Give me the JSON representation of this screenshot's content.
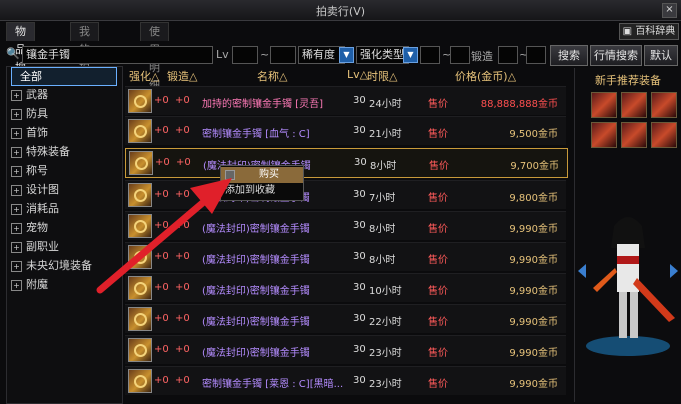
{
  "window": {
    "title": "拍卖行(V)",
    "close": "×"
  },
  "tabs": [
    {
      "label": "物品搜索"
    },
    {
      "label": "我的拍卖品"
    },
    {
      "label": "使用明细"
    }
  ],
  "wiki_button": "百科辞典",
  "filters": {
    "search_value": "镶金手镯",
    "lv_label": "Lv",
    "rarity": "稀有度",
    "enhance_type": "强化类型",
    "forge_label": "锻造",
    "search_button": "搜索",
    "market_button": "行情搜索",
    "default_button": "默认"
  },
  "sidebar": {
    "items": [
      {
        "label": "全部",
        "expandable": false
      },
      {
        "label": "武器",
        "expandable": true
      },
      {
        "label": "防具",
        "expandable": true
      },
      {
        "label": "首饰",
        "expandable": true
      },
      {
        "label": "特殊装备",
        "expandable": true
      },
      {
        "label": "称号",
        "expandable": true
      },
      {
        "label": "设计图",
        "expandable": true
      },
      {
        "label": "消耗品",
        "expandable": true
      },
      {
        "label": "宠物",
        "expandable": true
      },
      {
        "label": "副职业",
        "expandable": true
      },
      {
        "label": "未央幻境装备",
        "expandable": true
      },
      {
        "label": "附魔",
        "expandable": true
      }
    ]
  },
  "list_header": {
    "enhance": "强化△",
    "forge": "锻造△",
    "name": "名称△",
    "lv": "Lv△",
    "time": "时限△",
    "price": "价格(金币)△"
  },
  "rows": [
    {
      "enhance": "+0",
      "forge": "+0",
      "name": "加持的密制镶金手镯 [灵吾]",
      "lv": "30",
      "time": "24小时",
      "sell": "售价",
      "price": "88,888,888金币"
    },
    {
      "enhance": "+0",
      "forge": "+0",
      "name": "密制镶金手镯 [血气 : C]",
      "lv": "30",
      "time": "21小时",
      "sell": "售价",
      "price": "9,500金币"
    },
    {
      "enhance": "+0",
      "forge": "+0",
      "name": "(魔法封印)密制镶金手镯",
      "lv": "30",
      "time": "8小时",
      "sell": "售价",
      "price": "9,700金币"
    },
    {
      "enhance": "+0",
      "forge": "+0",
      "name": "(魔法封印)密制镶金手镯",
      "lv": "30",
      "time": "7小时",
      "sell": "售价",
      "price": "9,800金币"
    },
    {
      "enhance": "+0",
      "forge": "+0",
      "name": "(魔法封印)密制镶金手镯",
      "lv": "30",
      "time": "8小时",
      "sell": "售价",
      "price": "9,990金币"
    },
    {
      "enhance": "+0",
      "forge": "+0",
      "name": "(魔法封印)密制镶金手镯",
      "lv": "30",
      "time": "8小时",
      "sell": "售价",
      "price": "9,990金币"
    },
    {
      "enhance": "+0",
      "forge": "+0",
      "name": "(魔法封印)密制镶金手镯",
      "lv": "30",
      "time": "10小时",
      "sell": "售价",
      "price": "9,990金币"
    },
    {
      "enhance": "+0",
      "forge": "+0",
      "name": "(魔法封印)密制镶金手镯",
      "lv": "30",
      "time": "22小时",
      "sell": "售价",
      "price": "9,990金币"
    },
    {
      "enhance": "+0",
      "forge": "+0",
      "name": "(魔法封印)密制镶金手镯",
      "lv": "30",
      "time": "23小时",
      "sell": "售价",
      "price": "9,990金币"
    },
    {
      "enhance": "+0",
      "forge": "+0",
      "name": "密制镶金手镯 [莱恩 : C][黑暗...",
      "lv": "30",
      "time": "23小时",
      "sell": "售价",
      "price": "9,990金币"
    }
  ],
  "context_menu": {
    "buy": "购买",
    "add_fav": "添加到收藏"
  },
  "right_panel": {
    "title": "新手推荐装备"
  },
  "colors": {
    "accent_gold": "#e6c27a",
    "selection_border": "#c89a3a",
    "arrow_red": "#e0202a"
  }
}
